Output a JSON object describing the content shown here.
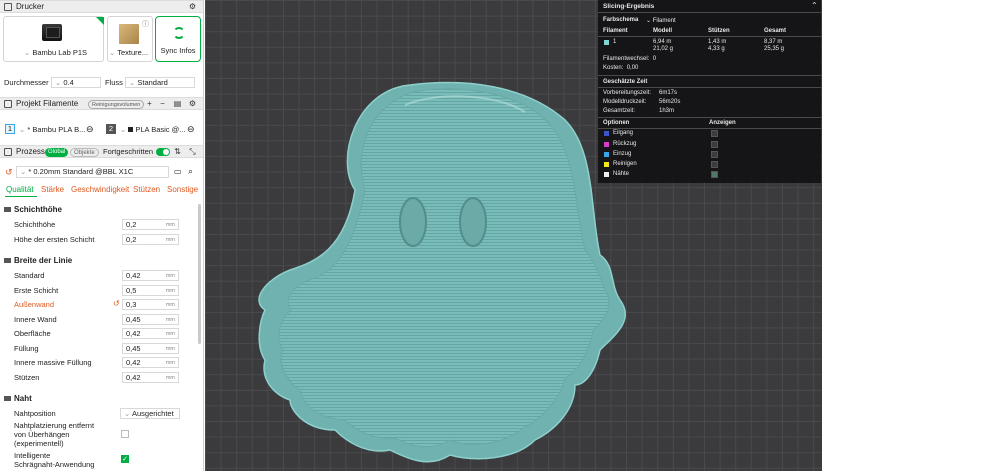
{
  "printer_section": {
    "title": "Drucker",
    "printer_name": "Bambu Lab P1S",
    "plate_name": "Texture...",
    "sync_label": "Sync Infos",
    "diameter_label": "Durchmesser",
    "diameter_value": "0.4",
    "flow_label": "Fluss",
    "flow_value": "Standard"
  },
  "filament_section": {
    "title": "Projekt Filamente",
    "purge_badge": "Reinigungsvolumen",
    "slot1_num": "1",
    "slot1_name": "* Bambu PLA B...",
    "slot2_num": "2",
    "slot2_name": "PLA Basic @..."
  },
  "process_section": {
    "title": "Prozess",
    "global_pill": "Global",
    "objects_pill": "Objekte",
    "advanced_label": "Fortgeschritten",
    "preset": "* 0.20mm Standard @BBL X1C"
  },
  "tabs": [
    "Qualität",
    "Stärke",
    "Geschwindigkeit",
    "Stützen",
    "Sonstige"
  ],
  "layer_height": {
    "title": "Schichthöhe",
    "rows": [
      {
        "label": "Schichthöhe",
        "value": "0,2",
        "unit": "mm"
      },
      {
        "label": "Höhe der ersten Schicht",
        "value": "0,2",
        "unit": "mm"
      }
    ]
  },
  "line_width": {
    "title": "Breite der Linie",
    "rows": [
      {
        "label": "Standard",
        "value": "0,42",
        "unit": "mm"
      },
      {
        "label": "Erste Schicht",
        "value": "0,5",
        "unit": "mm"
      },
      {
        "label": "Außenwand",
        "value": "0,3",
        "unit": "mm"
      },
      {
        "label": "Innere Wand",
        "value": "0,45",
        "unit": "mm"
      },
      {
        "label": "Oberfläche",
        "value": "0,42",
        "unit": "mm"
      },
      {
        "label": "Füllung",
        "value": "0,45",
        "unit": "mm"
      },
      {
        "label": "Innere massive Füllung",
        "value": "0,42",
        "unit": "mm"
      },
      {
        "label": "Stützen",
        "value": "0,42",
        "unit": "mm"
      }
    ]
  },
  "seam": {
    "title": "Naht",
    "position_label": "Nahtposition",
    "position_value": "Ausgerichtet",
    "placement_line1": "Nahtplatzierung entfernt",
    "placement_line2": "von Überhängen",
    "placement_line3": "(experimentell)",
    "smart_line1": "Intelligente",
    "smart_line2": "Schrägnaht-Anwendung"
  },
  "result": {
    "title": "Slicing-Ergebnis",
    "color_scheme_label": "Farbschema",
    "color_scheme_value": "Filament",
    "col_filament": "Filament",
    "col_model": "Modell",
    "col_support": "Stützen",
    "col_total": "Gesamt",
    "row_id": "1",
    "model_len": "6,94 m",
    "model_wt": "21,02 g",
    "support_len": "1,43 m",
    "support_wt": "4,33 g",
    "total_len": "8,37 m",
    "total_wt": "25,35 g",
    "changes_label": "Filamentwechsel:",
    "changes_value": "0",
    "cost_label": "Kosten:",
    "cost_value": "0,00",
    "time_title": "Geschätzte Zeit",
    "prep_label": "Vorbereitungszeit:",
    "prep_value": "6m17s",
    "model_time_label": "Modelldruckzeit:",
    "model_time_value": "56m20s",
    "total_time_label": "Gesamtzeit:",
    "total_time_value": "1h3m",
    "options_label": "Optionen",
    "display_label": "Anzeigen",
    "options": [
      {
        "label": "Eilgang",
        "color": "#3a54c9"
      },
      {
        "label": "Rückzug",
        "color": "#d43cc9"
      },
      {
        "label": "Einzug",
        "color": "#3aa6e8"
      },
      {
        "label": "Reinigen",
        "color": "#f2e71c"
      },
      {
        "label": "Nähte",
        "color": "#eeeeee"
      }
    ]
  },
  "colors": {
    "accent": "#00ae42",
    "warning": "#e05a22",
    "model": "#75b9b6",
    "filament_swatch": "#7ad7d2"
  }
}
